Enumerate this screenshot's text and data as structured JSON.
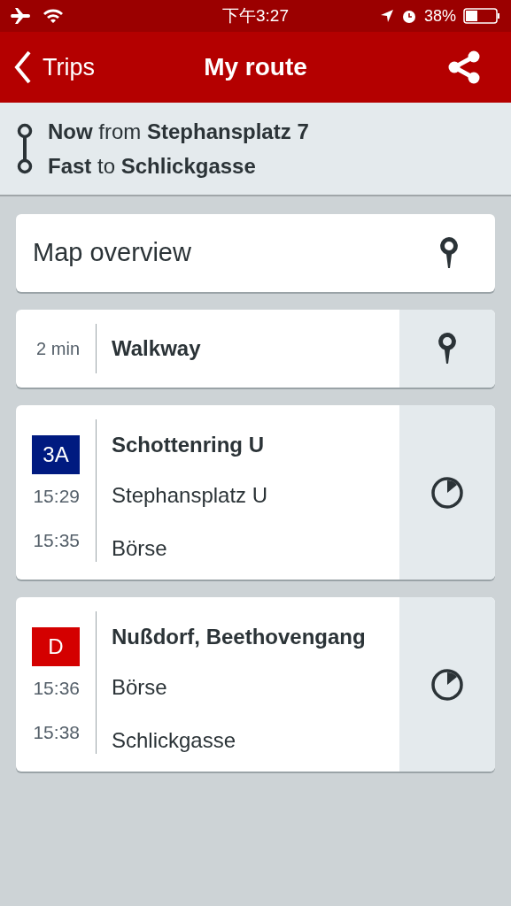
{
  "status_bar": {
    "time": "下午3:27",
    "battery": "38%"
  },
  "nav": {
    "back": "Trips",
    "title": "My route"
  },
  "summary": {
    "lines": [
      "**Now** from **Stephansplatz 7**",
      "**Fast** to **Schlickgasse**"
    ]
  },
  "map_overview": {
    "label": "Map overview"
  },
  "legs": [
    {
      "kind": "walk",
      "duration": "2 min",
      "label": "Walkway"
    },
    {
      "kind": "transit",
      "line": "3A",
      "color": "#001a80",
      "direction": "Schottenring U",
      "stops": [
        {
          "time": "15:29",
          "name": "Stephansplatz U"
        },
        {
          "time": "15:35",
          "name": "Börse"
        }
      ]
    },
    {
      "kind": "transit",
      "line": "D",
      "color": "#d40000",
      "direction": "Nußdorf, Beethovengang",
      "stops": [
        {
          "time": "15:36",
          "name": "Börse"
        },
        {
          "time": "15:38",
          "name": "Schlickgasse"
        }
      ]
    }
  ]
}
